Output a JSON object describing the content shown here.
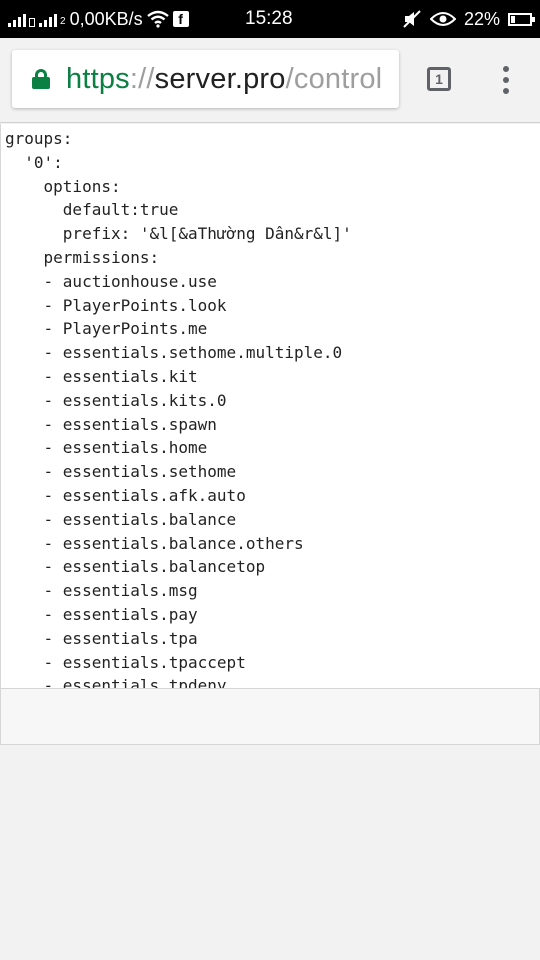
{
  "status_bar": {
    "net_speed": "0,00KB/s",
    "sim2_label": "2",
    "time": "15:28",
    "battery_percent": "22%",
    "battery_level": 0.22,
    "icons": [
      "signal-icon",
      "signal-icon",
      "wifi-icon",
      "facebook-icon",
      "mute-icon",
      "eye-icon",
      "battery-icon"
    ]
  },
  "toolbar": {
    "url_scheme": "https",
    "url_sep": "://",
    "url_host": "server.pro",
    "url_path": "/control",
    "tab_count": "1"
  },
  "editor": {
    "lines": [
      "groups:",
      "  '0':",
      "    options:",
      "      default:true",
      "      prefix: '&l[&aThường Dân&r&l]'",
      "    permissions:",
      "    - auctionhouse.use",
      "    - PlayerPoints.look",
      "    - PlayerPoints.me",
      "    - essentials.sethome.multiple.0",
      "    - essentials.kit",
      "    - essentials.kits.0",
      "    - essentials.spawn",
      "    - essentials.home",
      "    - essentials.sethome",
      "    - essentials.afk.auto",
      "    - essentials.balance",
      "    - essentials.balance.others",
      "    - essentials.balancetop",
      "    - essentials.msg",
      "    - essentials.pay",
      "    - essentials.tpa",
      "    - essentials.tpaccept",
      "    - essentials.tpdeny"
    ]
  },
  "colors": {
    "secure_green": "#0b8043",
    "status_bar_bg": "#000000",
    "toolbar_bg": "#f2f2f2"
  }
}
